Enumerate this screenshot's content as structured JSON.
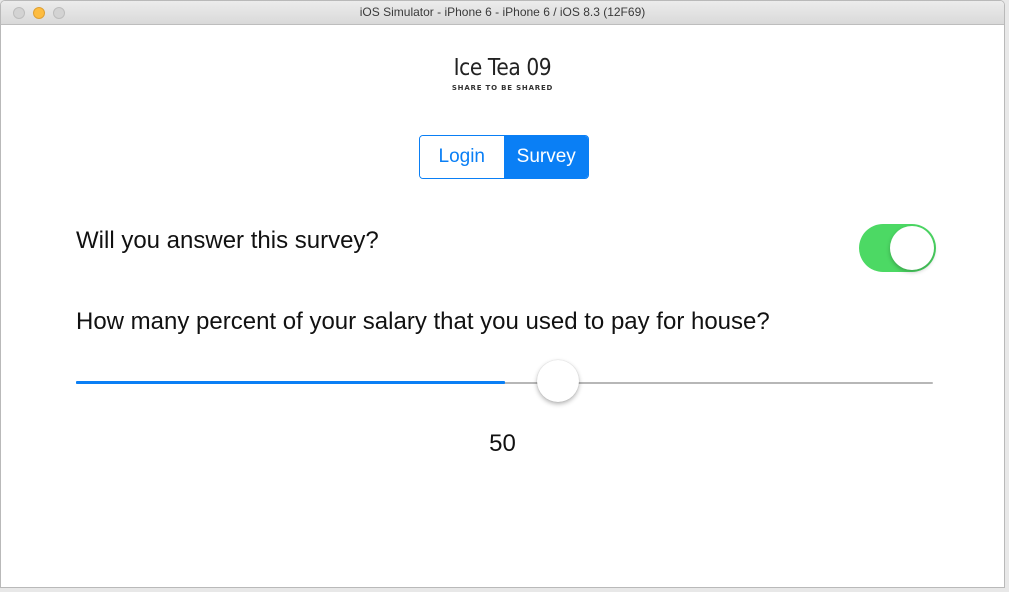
{
  "window": {
    "title": "iOS Simulator - iPhone 6 - iPhone 6 / iOS 8.3 (12F69)"
  },
  "app": {
    "logo_title": "Ice Tea 09",
    "logo_subtitle": "SHARE TO BE SHARED"
  },
  "segmented_control": {
    "login_label": "Login",
    "survey_label": "Survey",
    "selected": "Survey"
  },
  "survey": {
    "question1": "Will you answer this survey?",
    "question1_toggle_on": true,
    "question2": "How many percent of your salary that you used to pay for house?",
    "slider_value_fraction": 0.5,
    "slider_value_label": "50"
  },
  "colors": {
    "accent": "#0a7ff5",
    "toggle_on": "#4cd964",
    "minimize": "#fdbc40"
  }
}
